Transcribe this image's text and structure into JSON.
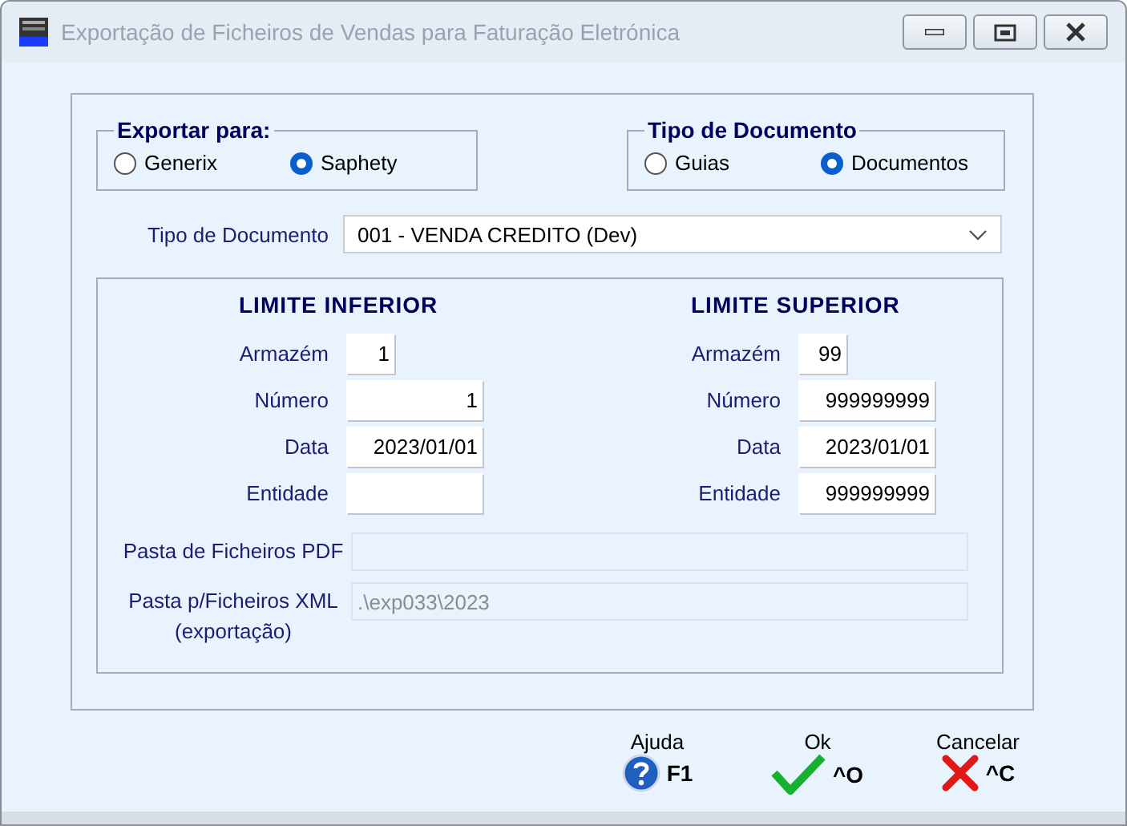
{
  "window": {
    "title": "Exportação de Ficheiros de Vendas para Faturação Eletrónica",
    "active": false
  },
  "groups": [
    {
      "title": "Exportar para:",
      "options": [
        {
          "label": "Generix",
          "selected": false
        },
        {
          "label": "Saphety",
          "selected": true
        }
      ]
    },
    {
      "title": "Tipo de Documento",
      "options": [
        {
          "label": "Guias",
          "selected": false
        },
        {
          "label": "Documentos",
          "selected": true
        }
      ]
    }
  ],
  "document_type": {
    "label": "Tipo de Documento",
    "value": "001 - VENDA CREDITO (Dev)"
  },
  "limits": [
    {
      "heading": "LIMITE INFERIOR",
      "fields": [
        {
          "label": "Armazém",
          "value": "1",
          "kind": "short"
        },
        {
          "label": "Número",
          "value": "1",
          "kind": "long"
        },
        {
          "label": "Data",
          "value": "2023/01/01",
          "kind": "long"
        },
        {
          "label": "Entidade",
          "kind": "long"
        }
      ]
    },
    {
      "heading": "LIMITE SUPERIOR",
      "fields": [
        {
          "label": "Armazém",
          "value": "99",
          "kind": "short"
        },
        {
          "label": "Número",
          "value": "999999999",
          "kind": "long"
        },
        {
          "label": "Data",
          "value": "2023/01/01",
          "kind": "long"
        },
        {
          "label": "Entidade",
          "value": "999999999",
          "kind": "long"
        }
      ]
    }
  ],
  "folders": [
    {
      "label": "Pasta de Ficheiros PDF",
      "disabled": true
    },
    {
      "label": "Pasta p/Ficheiros XML",
      "sublabel": "(exportação)",
      "value": ".\\exp033\\2023",
      "disabled": true
    }
  ],
  "buttons": [
    {
      "label": "Ajuda",
      "key": "F1",
      "kind": "help"
    },
    {
      "label": "Ok",
      "key": "^O",
      "kind": "ok"
    },
    {
      "label": "Cancelar",
      "key": "^C",
      "kind": "cancel"
    }
  ]
}
